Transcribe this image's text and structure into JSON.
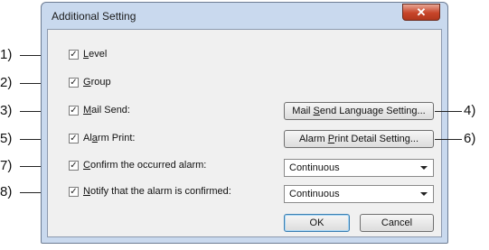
{
  "dialog": {
    "title": "Additional Setting",
    "close_glyph": "✕"
  },
  "checkboxes": [
    {
      "prefix": "",
      "accel": "L",
      "rest": "evel",
      "checked": true
    },
    {
      "prefix": "",
      "accel": "G",
      "rest": "roup",
      "checked": true
    },
    {
      "prefix": "",
      "accel": "M",
      "rest": "ail Send:",
      "checked": true
    },
    {
      "prefix": "Al",
      "accel": "a",
      "rest": "rm Print:",
      "checked": true
    },
    {
      "prefix": "",
      "accel": "C",
      "rest": "onfirm the occurred alarm:",
      "checked": true
    },
    {
      "prefix": "",
      "accel": "N",
      "rest": "otify that the alarm is confirmed:",
      "checked": true
    }
  ],
  "buttons": {
    "mail_lang": {
      "prefix": "Mail ",
      "accel": "S",
      "rest": "end Language Setting..."
    },
    "alarm_print": {
      "prefix": "Alarm ",
      "accel": "P",
      "rest": "rint Detail Setting..."
    },
    "ok": "OK",
    "cancel": "Cancel"
  },
  "selects": {
    "confirm_occurred": "Continuous",
    "notify_confirmed": "Continuous"
  },
  "callouts": {
    "left": [
      "1)",
      "2)",
      "3)",
      "5)",
      "7)",
      "8)"
    ],
    "right": [
      "4)",
      "6)"
    ]
  },
  "colors": {
    "frame": "#c9d9ee",
    "client": "#f0f0f0",
    "close_button": "#c7452a"
  }
}
